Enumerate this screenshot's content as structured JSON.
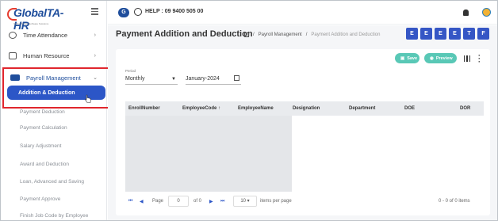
{
  "sidebar": {
    "logo_main": "Global",
    "logo_accent": "TA-HR",
    "logo_tagline": "Global TA-HR Software Solutions",
    "items": [
      {
        "label": "Time Attendance",
        "icon": "clock-icon"
      },
      {
        "label": "Human Resource",
        "icon": "people-icon"
      },
      {
        "label": "Payroll Management",
        "icon": "money-icon"
      }
    ],
    "active_sub": "Addition & Deduction",
    "sub_items": [
      "Payment Deduction",
      "Payment Calculation",
      "Salary Adjustment",
      "Award and Deduction",
      "Loan, Advanced and Saving",
      "Payment Approve",
      "Finish Job Code by Employee"
    ]
  },
  "topbar": {
    "help_text": "HELP : 09 9400 505 00"
  },
  "page": {
    "title": "Payment Addition and Deduction",
    "breadcrumb": [
      "Payroll Management",
      "Payment Addition and Deduction"
    ],
    "tool_buttons": [
      "E",
      "E",
      "E",
      "E",
      "T",
      "F"
    ],
    "save_label": "Save",
    "preview_label": "Preview"
  },
  "filters": {
    "period_label": "Period",
    "period_value": "Monthly",
    "month_value": "January-2024"
  },
  "grid": {
    "columns": [
      "EnrollNumber",
      "EmployeeCode ↑",
      "EmployeeName",
      "Designation",
      "Department",
      "DOE",
      "DOR"
    ]
  },
  "pager": {
    "page_label": "Page",
    "page_value": "0",
    "of_label": "of 0",
    "page_size": "10",
    "per_page_label": "items per page",
    "summary": "0 - 0 of 0 items"
  },
  "colors": {
    "brand": "#1f4e9c",
    "active_pill": "#2c56c7",
    "highlight_border": "#e0262d",
    "teal_button": "#59c8b6"
  }
}
